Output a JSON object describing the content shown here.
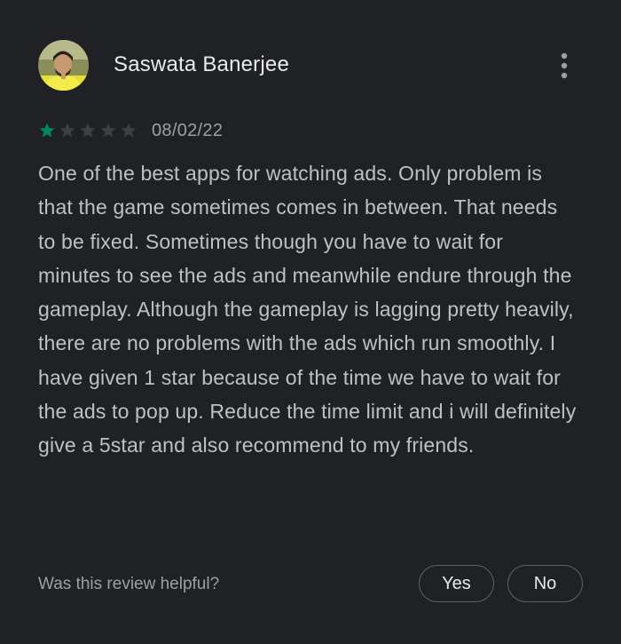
{
  "review": {
    "reviewer_name": "Saswata Banerjee",
    "date": "08/02/22",
    "rating": 1,
    "max_rating": 5,
    "text": "One of the best apps for watching ads. Only problem is that the game sometimes comes in between. That needs to be fixed. Sometimes though you have to wait for minutes to see the ads and meanwhile endure through the gameplay. Although the gameplay is lagging pretty heavily, there are no problems with the ads which run smoothly. I have given 1 star because of the time we have to wait for the ads to pop up. Reduce the time limit and i will definitely give a 5star and also recommend to my friends.",
    "avatar_icon": "user-photo-icon",
    "more_icon": "more-vert-icon"
  },
  "helpful": {
    "prompt": "Was this review helpful?",
    "yes_label": "Yes",
    "no_label": "No"
  },
  "colors": {
    "background": "#202124",
    "star_filled": "#01875f",
    "star_empty": "#5f6368",
    "name_text": "#e8eaed",
    "body_text": "#bdc1c6",
    "secondary_text": "#9aa0a6",
    "button_border": "#5f6368"
  }
}
